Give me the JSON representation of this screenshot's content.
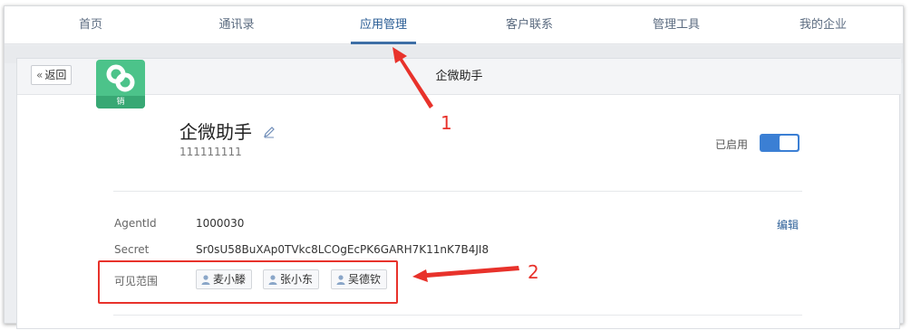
{
  "nav": {
    "items": [
      {
        "label": "首页"
      },
      {
        "label": "通讯录"
      },
      {
        "label": "应用管理"
      },
      {
        "label": "客户联系"
      },
      {
        "label": "管理工具"
      },
      {
        "label": "我的企业"
      }
    ],
    "active_index": 2
  },
  "header": {
    "back_label": "返回",
    "title": "企微助手"
  },
  "app": {
    "name": "企微助手",
    "id_text": "111111111",
    "icon_tag": "销",
    "status_label": "已启用",
    "enabled": true,
    "icon_color": "#4cc38a"
  },
  "details": {
    "agentid_label": "AgentId",
    "agentid_value": "1000030",
    "secret_label": "Secret",
    "secret_value": "Sr0sU58BuXAp0TVkc8LCOgEcPK6GARH7K11nK7B4JI8",
    "edit_label": "编辑",
    "visibility_label": "可见范围",
    "visible_users": [
      "麦小滕",
      "张小东",
      "吴德钦"
    ]
  },
  "annotations": {
    "marker_1": "1",
    "marker_2": "2",
    "color": "#e8322b"
  }
}
